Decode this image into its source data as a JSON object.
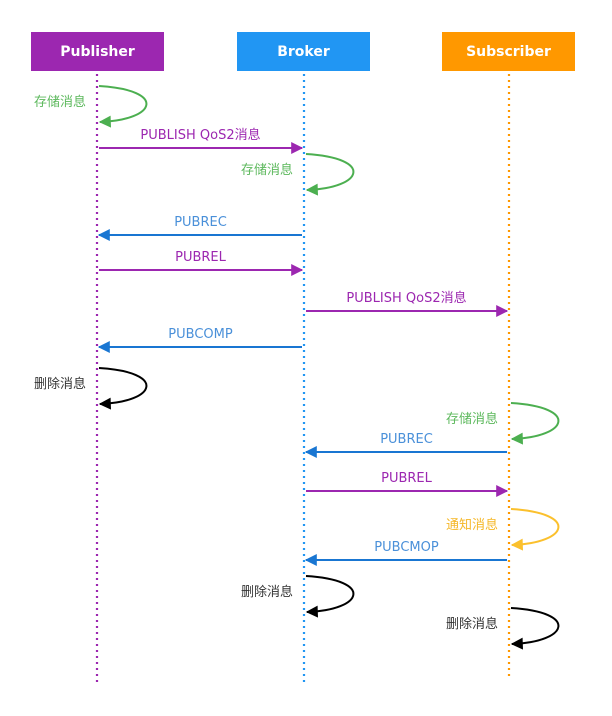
{
  "actors": [
    {
      "id": "publisher",
      "label": "Publisher",
      "color": "#9c27b0"
    },
    {
      "id": "broker",
      "label": "Broker",
      "color": "#2196f3"
    },
    {
      "id": "subscriber",
      "label": "Subscriber",
      "color": "#ff9800"
    }
  ],
  "colors": {
    "publish": "#9c27b0",
    "ack": "#1976d2",
    "ack_text": "#4a90d9",
    "store": "#4caf50",
    "store_text": "#5cb85c",
    "notify": "#fbc02d",
    "notify_text": "#f5b727",
    "delete": "#000000",
    "delete_text": "#333333"
  },
  "steps": [
    {
      "type": "self",
      "actor": "publisher",
      "label": "存储消息",
      "kind": "store"
    },
    {
      "type": "message",
      "from": "publisher",
      "to": "broker",
      "label": "PUBLISH QoS2消息",
      "kind": "publish"
    },
    {
      "type": "self",
      "actor": "broker",
      "label": "存储消息",
      "kind": "store"
    },
    {
      "type": "message",
      "from": "broker",
      "to": "publisher",
      "label": "PUBREC",
      "kind": "ack"
    },
    {
      "type": "message",
      "from": "publisher",
      "to": "broker",
      "label": "PUBREL",
      "kind": "publish"
    },
    {
      "type": "message",
      "from": "broker",
      "to": "subscriber",
      "label": "PUBLISH QoS2消息",
      "kind": "publish"
    },
    {
      "type": "message",
      "from": "broker",
      "to": "publisher",
      "label": "PUBCOMP",
      "kind": "ack"
    },
    {
      "type": "self",
      "actor": "publisher",
      "label": "删除消息",
      "kind": "delete"
    },
    {
      "type": "self",
      "actor": "subscriber",
      "label": "存储消息",
      "kind": "store"
    },
    {
      "type": "message",
      "from": "subscriber",
      "to": "broker",
      "label": "PUBREC",
      "kind": "ack"
    },
    {
      "type": "message",
      "from": "broker",
      "to": "subscriber",
      "label": "PUBREL",
      "kind": "publish"
    },
    {
      "type": "self",
      "actor": "subscriber",
      "label": "通知消息",
      "kind": "notify"
    },
    {
      "type": "message",
      "from": "subscriber",
      "to": "broker",
      "label": "PUBCMOP",
      "kind": "ack"
    },
    {
      "type": "self",
      "actor": "broker",
      "label": "删除消息",
      "kind": "delete"
    },
    {
      "type": "self",
      "actor": "subscriber",
      "label": "删除消息",
      "kind": "delete"
    }
  ]
}
